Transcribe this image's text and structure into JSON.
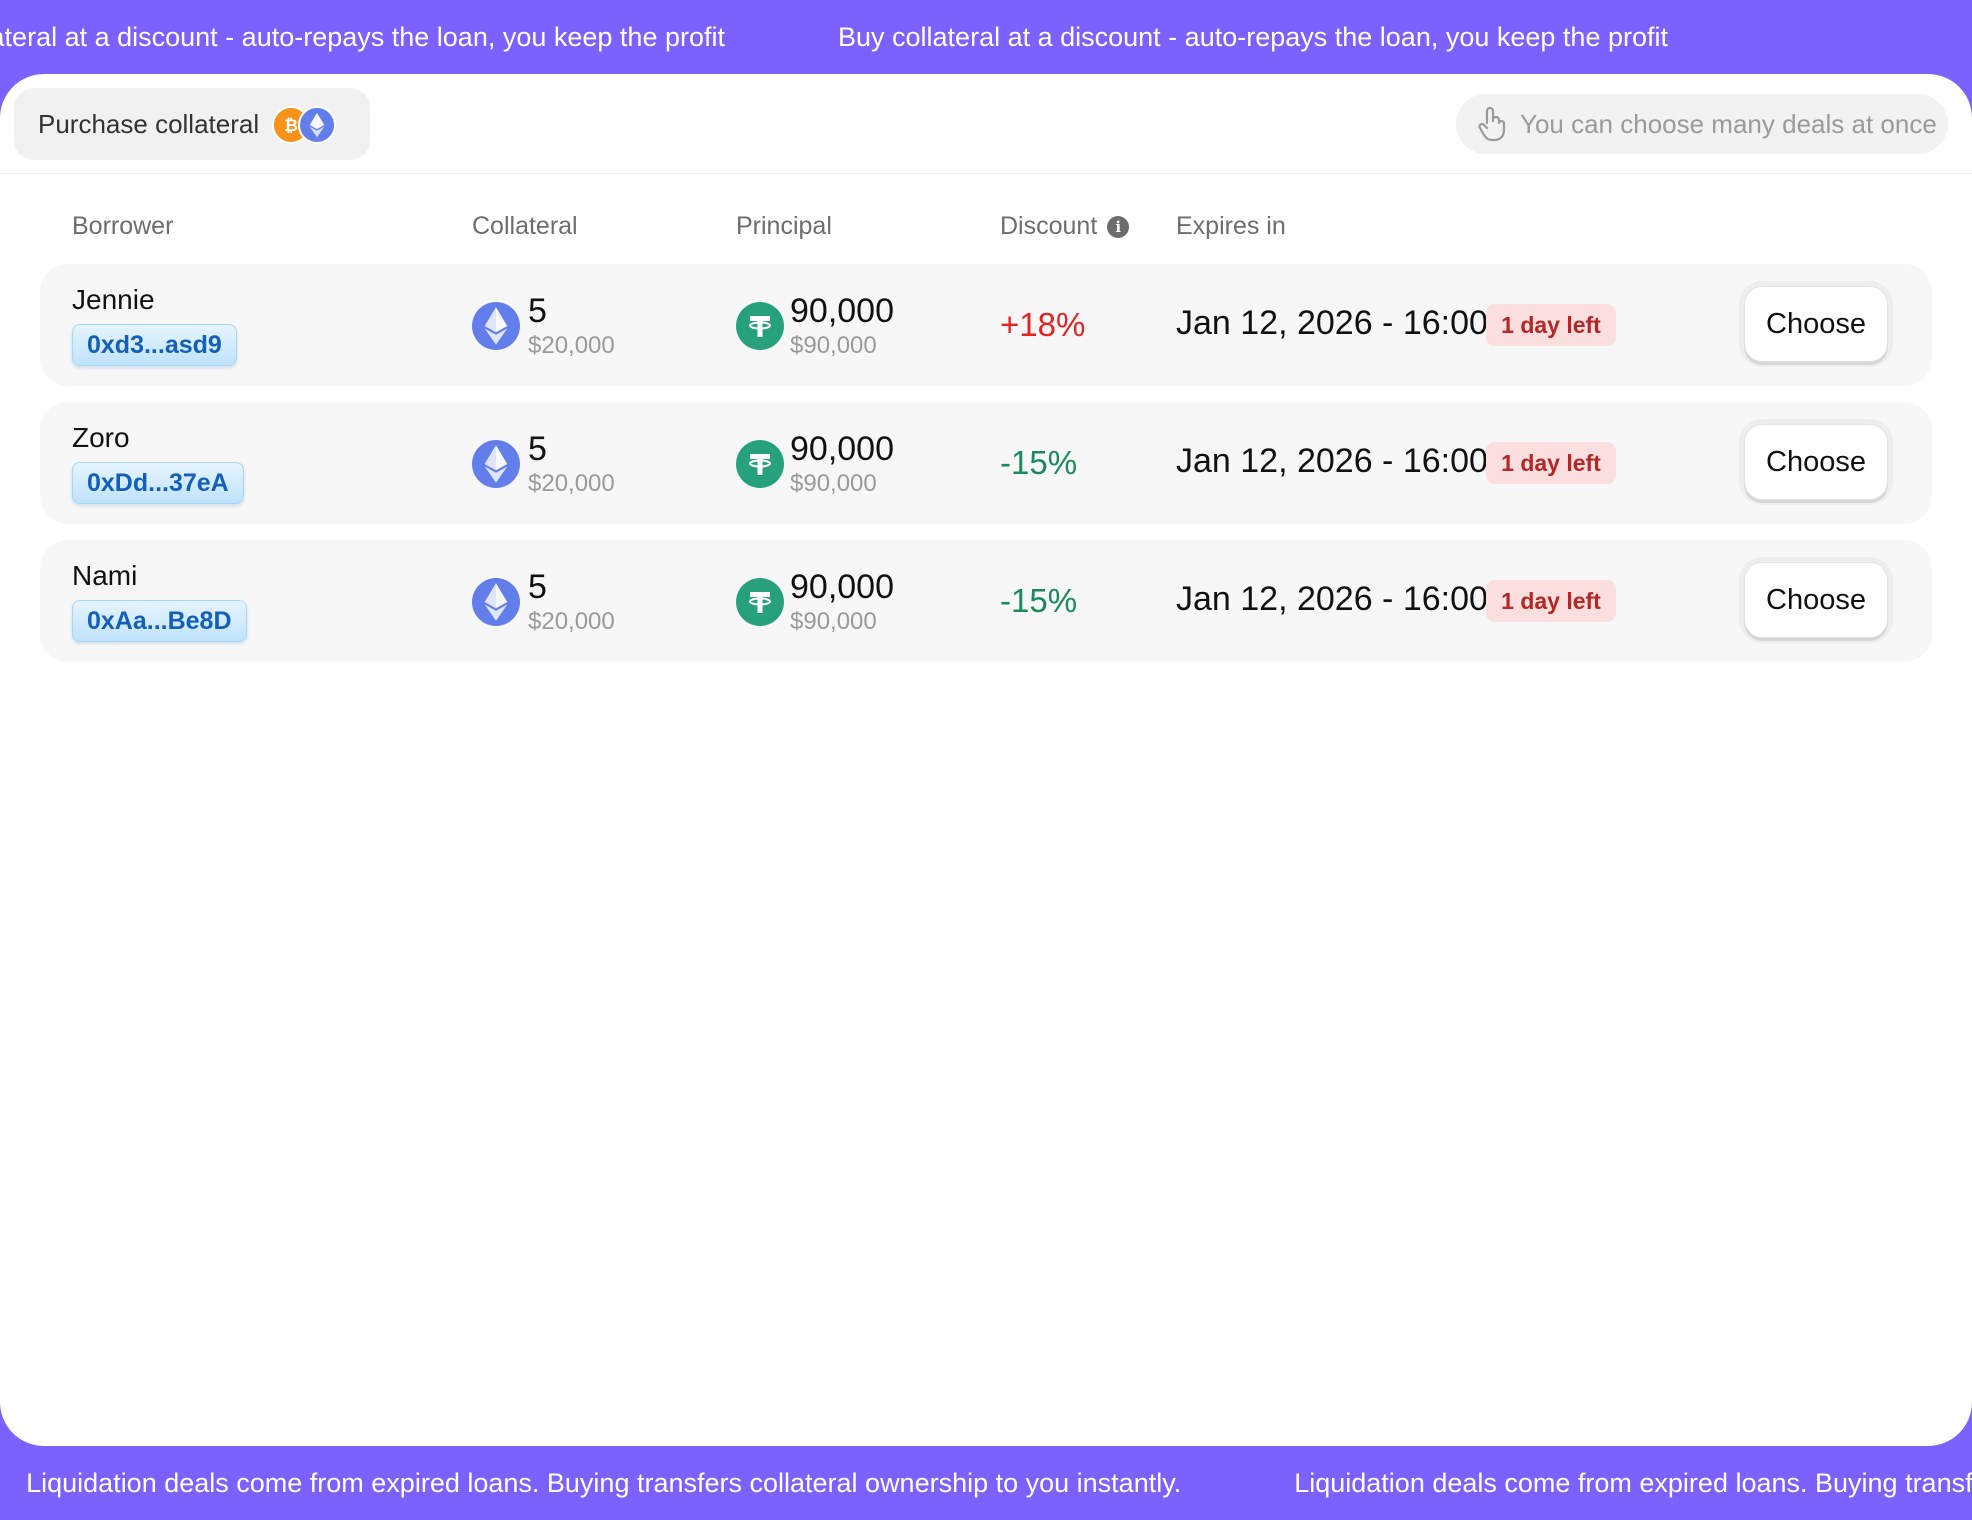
{
  "top_banner": {
    "text": "Buy collateral at a discount - auto-repays the loan, you keep the profit"
  },
  "bottom_banner": {
    "text": "Liquidation deals come from expired loans. Buying transfers collateral ownership to you instantly."
  },
  "toolbar": {
    "purchase_label": "Purchase collateral",
    "hint": "You can choose many deals at once"
  },
  "table": {
    "headers": {
      "borrower": "Borrower",
      "collateral": "Collateral",
      "principal": "Principal",
      "discount": "Discount",
      "expires": "Expires in"
    },
    "rows": [
      {
        "name": "Jennie",
        "address": "0xd3...asd9",
        "collateral_amount": "5",
        "collateral_usd": "$20,000",
        "principal_amount": "90,000",
        "principal_usd": "$90,000",
        "discount": "+18%",
        "discount_color": "#e02424",
        "expires": "Jan 12, 2026 - 16:00",
        "time_left": "1 day left",
        "action": "Choose"
      },
      {
        "name": "Zoro",
        "address": "0xDd...37eA",
        "collateral_amount": "5",
        "collateral_usd": "$20,000",
        "principal_amount": "90,000",
        "principal_usd": "$90,000",
        "discount": "-15%",
        "discount_color": "#1a8a5a",
        "expires": "Jan 12, 2026 - 16:00",
        "time_left": "1 day left",
        "action": "Choose"
      },
      {
        "name": "Nami",
        "address": "0xAa...Be8D",
        "collateral_amount": "5",
        "collateral_usd": "$20,000",
        "principal_amount": "90,000",
        "principal_usd": "$90,000",
        "discount": "-15%",
        "discount_color": "#1a8a5a",
        "expires": "Jan 12, 2026 - 16:00",
        "time_left": "1 day left",
        "action": "Choose"
      }
    ]
  },
  "colors": {
    "accent": "#7b61fd",
    "negative": "#e02424",
    "positive": "#1a8a5a",
    "badge_bg": "#fbdede"
  },
  "icons": {
    "collateral": "ethereum-icon",
    "principal": "tether-icon",
    "purchase_coins": [
      "bitcoin-icon",
      "ethereum-icon"
    ],
    "hint": "hand-pointer-icon",
    "discount_info": "info-icon"
  }
}
